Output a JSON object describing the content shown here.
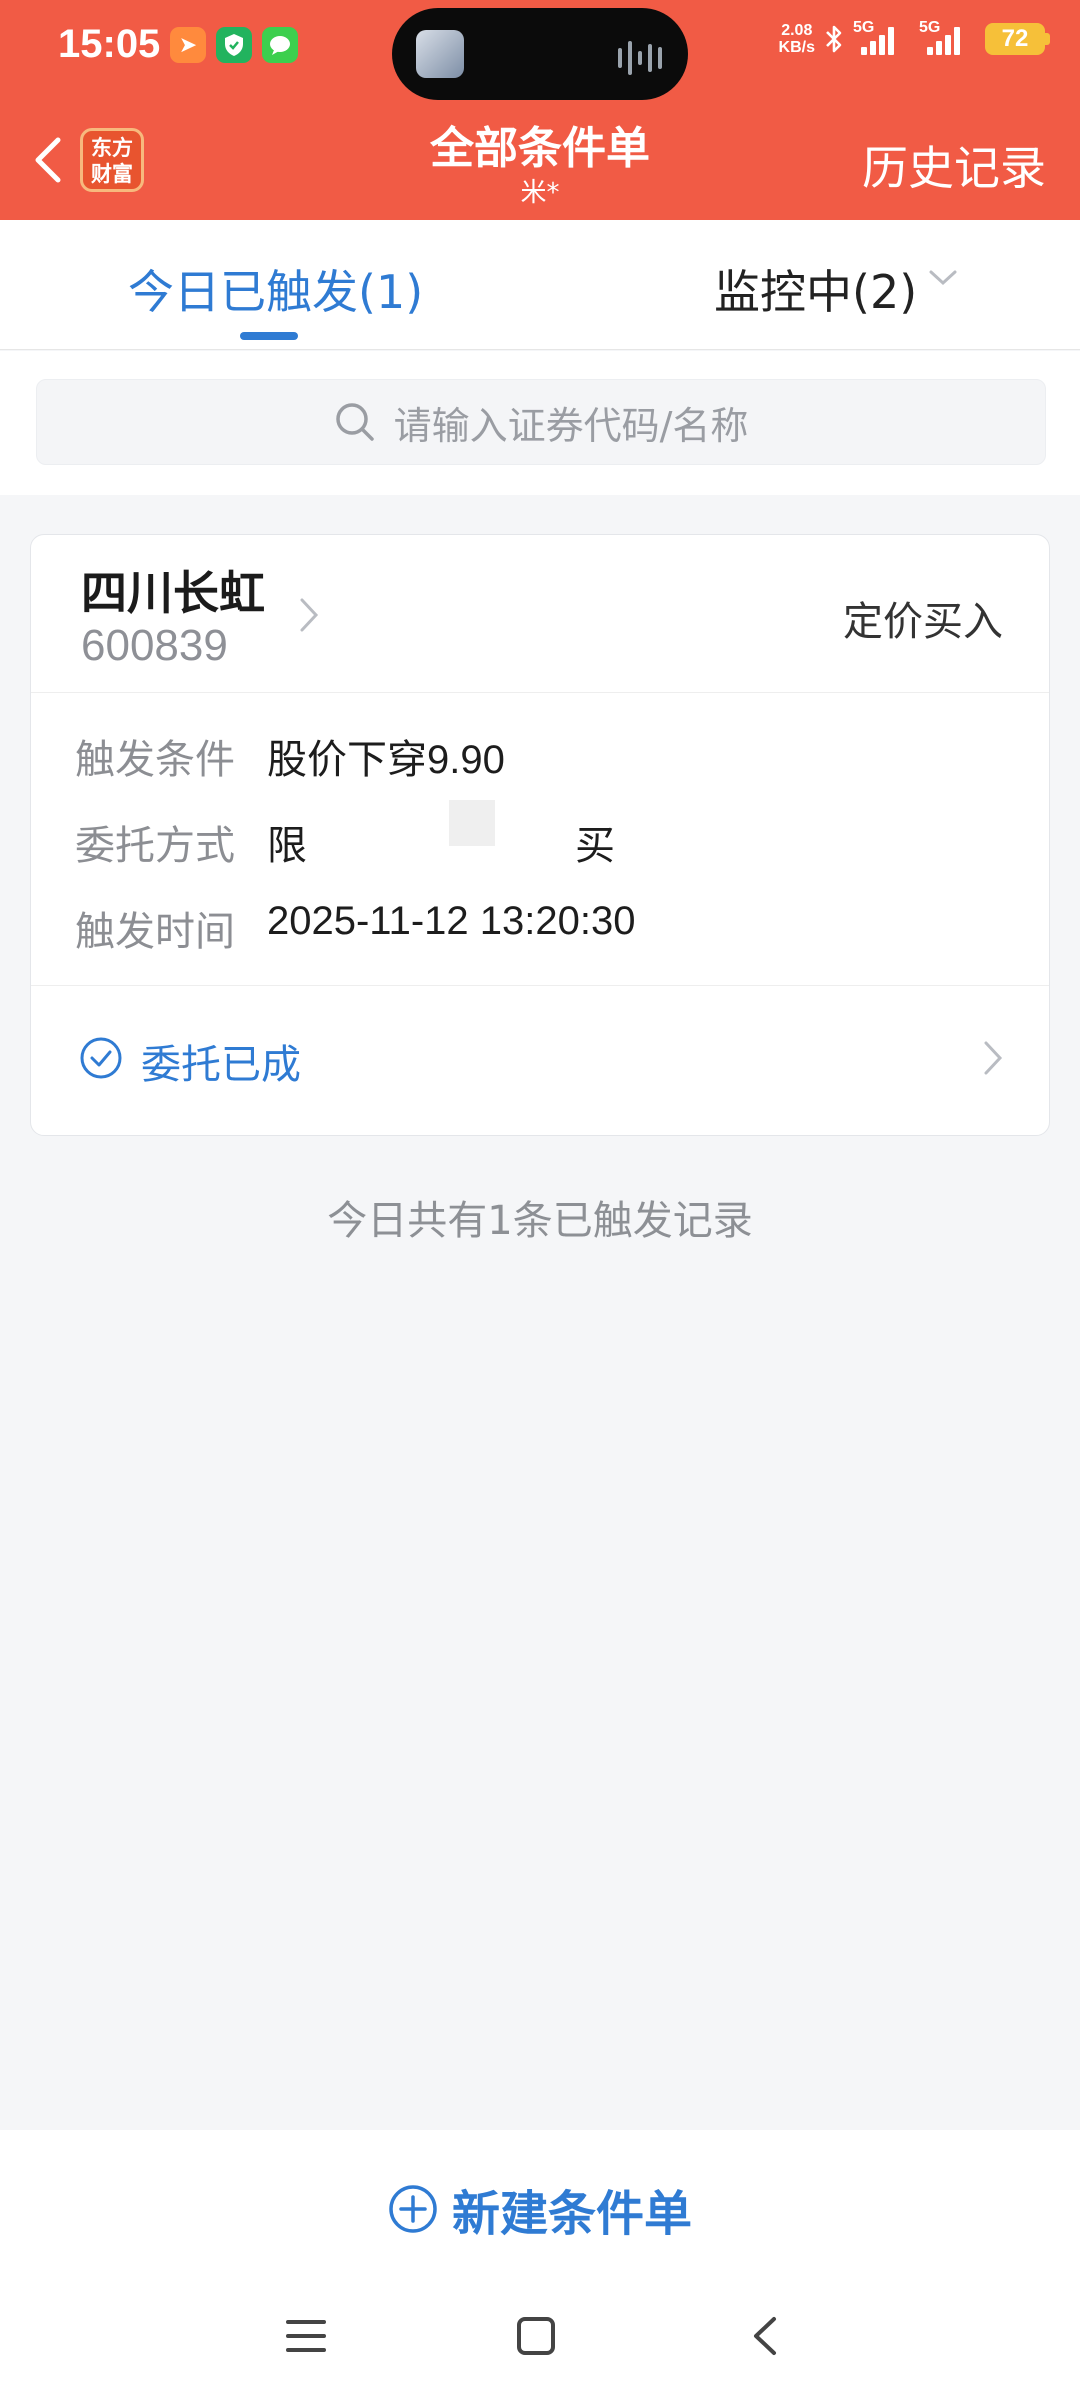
{
  "status_bar": {
    "time": "15:05",
    "net_speed_value": "2.08",
    "net_speed_unit": "KB/s",
    "sim1": "5G",
    "sim2": "5G",
    "battery": "72"
  },
  "header": {
    "logo_line1": "东方",
    "logo_line2": "财富",
    "title": "全部条件单",
    "subtitle": "米*",
    "history_link": "历史记录"
  },
  "tabs": [
    {
      "label": "今日已触发(1)",
      "active": true
    },
    {
      "label": "监控中(2)",
      "active": false
    }
  ],
  "search": {
    "placeholder": "请输入证券代码/名称"
  },
  "order_card": {
    "stock_name": "四川长虹",
    "stock_code": "600839",
    "order_type": "定价买入",
    "rows": [
      {
        "label": "触发条件",
        "value": "股价下穿9.90"
      },
      {
        "label": "委托方式",
        "value_prefix": "限",
        "value_red": "买"
      },
      {
        "label": "触发时间",
        "value": "2025-11-12 13:20:30"
      }
    ],
    "status": "委托已成"
  },
  "summary": "今日共有1条已触发记录",
  "bottom": {
    "new_order_label": "新建条件单"
  },
  "colors": {
    "header_bg": "#f15b45",
    "accent_blue": "#2f7bd3",
    "buy_red": "#d22b2b",
    "battery": "#f6c039"
  }
}
